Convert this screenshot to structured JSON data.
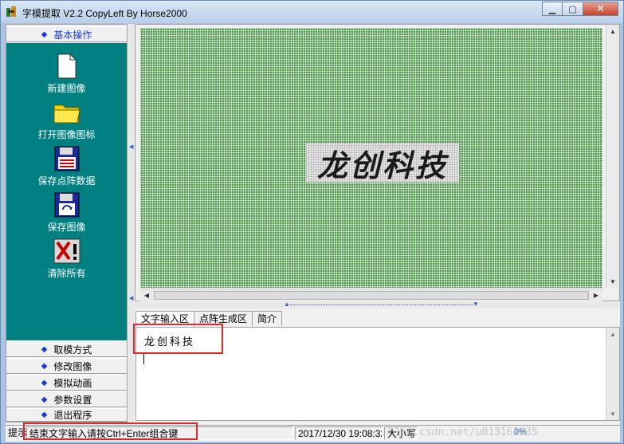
{
  "window": {
    "title": "字模提取 V2.2  CopyLeft By Horse2000",
    "minimize": "▁",
    "maximize": "▢",
    "close": "✕"
  },
  "left_panel": {
    "top_category": "基本操作",
    "tools": [
      {
        "label": "新建图像",
        "icon": "new-file-icon"
      },
      {
        "label": "打开图像图标",
        "icon": "open-folder-icon"
      },
      {
        "label": "保存点阵数据",
        "icon": "save-dotmatrix-icon"
      },
      {
        "label": "保存图像",
        "icon": "save-image-icon"
      },
      {
        "label": "清除所有",
        "icon": "clear-all-icon"
      }
    ],
    "bottom_categories": [
      "取模方式",
      "修改图像",
      "模拟动画",
      "参数设置",
      "退出程序"
    ]
  },
  "canvas": {
    "preview_text": "龙创科技",
    "grid_color": "#4f9a4f"
  },
  "tabs": [
    "文字输入区",
    "点阵生成区",
    "简介"
  ],
  "text_input": {
    "content": "龙创科技"
  },
  "status_bar": {
    "hint_label": "提示:",
    "hint": "结束文字输入请按Ctrl+Enter组合键",
    "datetime": "2017/12/30 19:08:32",
    "caps": "大小写",
    "watermark": "blog.csdn.net/u013162035",
    "percent": "0%"
  },
  "colors": {
    "teal_panel": "#008080",
    "accent_blue": "#1a3dcf",
    "highlight_red": "#e0282c"
  }
}
